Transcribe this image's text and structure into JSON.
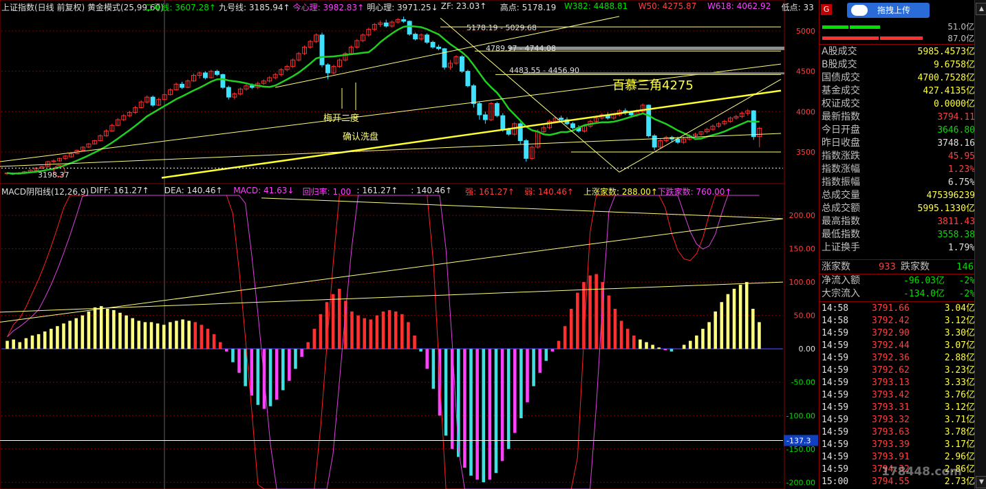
{
  "header": {
    "index_label": "上证指数(日线 前复权) 黄金模式(25,99,60)",
    "items": [
      {
        "text": "二号线: 3607.28↑",
        "color": "#00e000"
      },
      {
        "text": "九号线: 3185.94↑",
        "color": "#e0e0e0"
      },
      {
        "text": "今心理: 3982.83↑",
        "color": "#ff40ff"
      },
      {
        "text": "明心理: 3971.25↓",
        "color": "#e0e0e0"
      },
      {
        "text": "ZF: 23.03↑",
        "color": "#e0e0e0"
      },
      {
        "text": "高点: 5178.19",
        "color": "#e0e0e0"
      },
      {
        "text": "W382: 4488.81",
        "color": "#00e000"
      },
      {
        "text": "W50: 4275.87",
        "color": "#ff4040"
      },
      {
        "text": "W618: 4062.92",
        "color": "#ff40ff"
      },
      {
        "text": "低点: 33",
        "color": "#e0e0e0"
      }
    ]
  },
  "macd_header": {
    "items": [
      {
        "text": "MACD阴阳线(12,26,9)",
        "color": "#e0e0e0"
      },
      {
        "text": "DIFF: 161.27↑",
        "color": "#e0e0e0"
      },
      {
        "text": "DEA: 140.46↑",
        "color": "#e0e0e0"
      },
      {
        "text": "MACD: 41.63↓",
        "color": "#ff40ff"
      },
      {
        "text": "回归率: 1.00",
        "color": "#ff40ff"
      },
      {
        "text": ": 161.27↑",
        "color": "#e0e0e0"
      },
      {
        "text": ": 140.46↑",
        "color": "#e0e0e0"
      },
      {
        "text": "强: 161.27↑",
        "color": "#ff4040"
      },
      {
        "text": "弱: 140.46↑",
        "color": "#ff4040"
      },
      {
        "text": "上涨家数: 288.00↑",
        "color": "#ffff40"
      },
      {
        "text": "下跌家数: 760.00↑",
        "color": "#ff40ff"
      }
    ]
  },
  "annotations": {
    "a1": "5178.19 - 5029.68",
    "a2": "4789.97 - 4744.08",
    "a3": "4483.55 - 4456.90",
    "big": "百慕三角4275",
    "meikai": "梅开二度",
    "queren": "确认洗盘",
    "low": "3198.37",
    "macd_val": "-137.3"
  },
  "colors": {
    "up": "#ff3030",
    "down": "#40e0ff",
    "ma_green": "#20d020",
    "ma_yellow": "#ffff30",
    "grid": "#8b0000"
  },
  "chart_data": [
    {
      "type": "candlestick",
      "title": "上证指数(日线 前复权)",
      "ylim": [
        3198,
        5200
      ],
      "yticks": [
        3500,
        4000,
        4500,
        5000
      ],
      "candles": [
        [
          3230,
          3240,
          3215,
          3245
        ],
        [
          3235,
          3225,
          3215,
          3245
        ],
        [
          3225,
          3240,
          3220,
          3250
        ],
        [
          3240,
          3255,
          3235,
          3265
        ],
        [
          3255,
          3275,
          3250,
          3285
        ],
        [
          3270,
          3300,
          3265,
          3310
        ],
        [
          3300,
          3320,
          3290,
          3330
        ],
        [
          3320,
          3380,
          3310,
          3390
        ],
        [
          3380,
          3390,
          3360,
          3410
        ],
        [
          3390,
          3420,
          3380,
          3430
        ],
        [
          3420,
          3450,
          3400,
          3460
        ],
        [
          3440,
          3480,
          3430,
          3490
        ],
        [
          3480,
          3520,
          3470,
          3530
        ],
        [
          3520,
          3560,
          3510,
          3570
        ],
        [
          3560,
          3600,
          3550,
          3610
        ],
        [
          3600,
          3640,
          3590,
          3650
        ],
        [
          3640,
          3700,
          3630,
          3720
        ],
        [
          3700,
          3760,
          3690,
          3780
        ],
        [
          3760,
          3830,
          3750,
          3850
        ],
        [
          3830,
          3900,
          3820,
          3920
        ],
        [
          3900,
          3950,
          3880,
          3970
        ],
        [
          3950,
          3990,
          3930,
          4010
        ],
        [
          3990,
          4050,
          3970,
          4070
        ],
        [
          4050,
          4120,
          4040,
          4140
        ],
        [
          4120,
          4180,
          4100,
          4200
        ],
        [
          4180,
          4080,
          4060,
          4200
        ],
        [
          4080,
          4150,
          4070,
          4170
        ],
        [
          4150,
          4210,
          4140,
          4230
        ],
        [
          4210,
          4270,
          4200,
          4290
        ],
        [
          4270,
          4340,
          4260,
          4360
        ],
        [
          4340,
          4300,
          4280,
          4370
        ],
        [
          4300,
          4380,
          4290,
          4400
        ],
        [
          4380,
          4450,
          4370,
          4470
        ],
        [
          4450,
          4480,
          4410,
          4500
        ],
        [
          4480,
          4420,
          4400,
          4500
        ],
        [
          4420,
          4500,
          4410,
          4520
        ],
        [
          4500,
          4460,
          4440,
          4520
        ],
        [
          4460,
          4300,
          4280,
          4470
        ],
        [
          4300,
          4180,
          4150,
          4320
        ],
        [
          4180,
          4220,
          4150,
          4240
        ],
        [
          4220,
          4280,
          4200,
          4300
        ],
        [
          4280,
          4320,
          4260,
          4340
        ],
        [
          4320,
          4300,
          4280,
          4350
        ],
        [
          4300,
          4350,
          4280,
          4370
        ],
        [
          4350,
          4380,
          4330,
          4400
        ],
        [
          4380,
          4420,
          4360,
          4440
        ],
        [
          4420,
          4460,
          4400,
          4480
        ],
        [
          4460,
          4520,
          4440,
          4540
        ],
        [
          4520,
          4560,
          4500,
          4580
        ],
        [
          4560,
          4640,
          4540,
          4660
        ],
        [
          4640,
          4720,
          4620,
          4740
        ],
        [
          4720,
          4800,
          4700,
          4820
        ],
        [
          4800,
          4870,
          4780,
          4890
        ],
        [
          4870,
          4950,
          4850,
          4970
        ],
        [
          4950,
          4580,
          4550,
          4980
        ],
        [
          4580,
          4480,
          4400,
          4600
        ],
        [
          4480,
          4560,
          4460,
          4580
        ],
        [
          4560,
          4640,
          4540,
          4660
        ],
        [
          4640,
          4720,
          4620,
          4740
        ],
        [
          4720,
          4800,
          4700,
          4820
        ],
        [
          4800,
          4880,
          4780,
          4900
        ],
        [
          4880,
          4950,
          4860,
          4970
        ],
        [
          4950,
          5020,
          4930,
          5040
        ],
        [
          5020,
          5080,
          5000,
          5100
        ],
        [
          5080,
          5100,
          5050,
          5130
        ],
        [
          5100,
          5060,
          5040,
          5140
        ],
        [
          5060,
          5110,
          5040,
          5130
        ],
        [
          5110,
          5140,
          5090,
          5160
        ],
        [
          5140,
          5120,
          5100,
          5178
        ],
        [
          5120,
          4960,
          4940,
          5130
        ],
        [
          4960,
          4900,
          4880,
          4980
        ],
        [
          4900,
          4950,
          4880,
          4970
        ],
        [
          4950,
          4860,
          4840,
          4970
        ],
        [
          4860,
          4800,
          4780,
          4880
        ],
        [
          4800,
          4780,
          4760,
          4830
        ],
        [
          4780,
          4550,
          4520,
          4790
        ],
        [
          4550,
          4600,
          4520,
          4640
        ],
        [
          4600,
          4680,
          4580,
          4700
        ],
        [
          4680,
          4500,
          4480,
          4700
        ],
        [
          4500,
          4320,
          4300,
          4520
        ],
        [
          4320,
          4100,
          4050,
          4340
        ],
        [
          4100,
          3960,
          3900,
          4120
        ],
        [
          3960,
          3900,
          3850,
          4000
        ],
        [
          3900,
          4100,
          3880,
          4120
        ],
        [
          4100,
          3950,
          3930,
          4120
        ],
        [
          3950,
          3780,
          3750,
          3980
        ],
        [
          3780,
          3720,
          3700,
          3800
        ],
        [
          3720,
          3850,
          3700,
          3870
        ],
        [
          3850,
          3640,
          3600,
          3870
        ],
        [
          3640,
          3420,
          3380,
          3660
        ],
        [
          3420,
          3560,
          3400,
          3580
        ],
        [
          3560,
          3750,
          3540,
          3780
        ],
        [
          3750,
          3800,
          3730,
          3830
        ],
        [
          3800,
          3880,
          3780,
          3900
        ],
        [
          3880,
          3920,
          3860,
          3940
        ],
        [
          3920,
          3900,
          3870,
          3950
        ],
        [
          3900,
          3850,
          3830,
          3930
        ],
        [
          3850,
          3800,
          3780,
          3870
        ],
        [
          3800,
          3760,
          3740,
          3830
        ],
        [
          3760,
          3820,
          3740,
          3840
        ],
        [
          3820,
          3880,
          3800,
          3900
        ],
        [
          3880,
          3920,
          3860,
          3950
        ],
        [
          3920,
          3960,
          3900,
          3980
        ],
        [
          3960,
          3920,
          3900,
          3990
        ],
        [
          3920,
          3960,
          3900,
          3980
        ],
        [
          3960,
          4010,
          3940,
          4030
        ],
        [
          4010,
          3990,
          3960,
          4040
        ],
        [
          3990,
          3960,
          3940,
          4010
        ],
        [
          3960,
          4000,
          3940,
          4030
        ],
        [
          4000,
          4080,
          3980,
          4100
        ],
        [
          4080,
          3700,
          3680,
          4090
        ],
        [
          3700,
          3560,
          3520,
          3720
        ],
        [
          3560,
          3640,
          3540,
          3660
        ],
        [
          3640,
          3680,
          3620,
          3700
        ],
        [
          3680,
          3660,
          3620,
          3700
        ],
        [
          3660,
          3620,
          3600,
          3690
        ],
        [
          3620,
          3660,
          3600,
          3690
        ],
        [
          3660,
          3700,
          3640,
          3720
        ],
        [
          3700,
          3720,
          3680,
          3740
        ],
        [
          3720,
          3750,
          3700,
          3760
        ],
        [
          3750,
          3780,
          3730,
          3800
        ],
        [
          3780,
          3820,
          3760,
          3840
        ],
        [
          3820,
          3850,
          3800,
          3870
        ],
        [
          3850,
          3880,
          3830,
          3900
        ],
        [
          3880,
          3920,
          3860,
          3940
        ],
        [
          3920,
          3940,
          3900,
          3960
        ],
        [
          3940,
          3980,
          3920,
          4000
        ],
        [
          3980,
          4010,
          3950,
          4030
        ],
        [
          4010,
          3690,
          3650,
          4020
        ],
        [
          3690,
          3794,
          3558,
          3811
        ]
      ]
    },
    {
      "type": "bar",
      "title": "MACD阴阳线(12,26,9)",
      "ylim": [
        -210,
        230
      ],
      "yticks": [
        -200,
        -150,
        -100,
        -50,
        0,
        50,
        100,
        150,
        200
      ],
      "macd_hist": [
        12,
        14,
        10,
        16,
        20,
        22,
        26,
        30,
        34,
        38,
        42,
        46,
        50,
        56,
        62,
        64,
        60,
        58,
        54,
        50,
        46,
        42,
        40,
        40,
        38,
        36,
        40,
        42,
        44,
        42,
        40,
        36,
        30,
        22,
        10,
        -4,
        -20,
        -36,
        -56,
        -70,
        -84,
        -90,
        -86,
        -76,
        -62,
        -48,
        -30,
        -12,
        10,
        30,
        52,
        70,
        82,
        90,
        72,
        56,
        50,
        46,
        44,
        50,
        56,
        58,
        56,
        52,
        40,
        20,
        -4,
        -30,
        -60,
        -100,
        -130,
        -150,
        -162,
        -178,
        -190,
        -196,
        -200,
        -196,
        -186,
        -168,
        -150,
        -126,
        -104,
        -80,
        -56,
        -36,
        -18,
        -4,
        12,
        34,
        60,
        84,
        100,
        110,
        112,
        100,
        80,
        60,
        42,
        30,
        20,
        14,
        10,
        6,
        2,
        -2,
        -4,
        0,
        6,
        12,
        20,
        30,
        40,
        56,
        70,
        82,
        90,
        96,
        100,
        60,
        40
      ]
    }
  ],
  "side": {
    "stats": [
      {
        "k": "A股成交",
        "v": "5985.4573亿",
        "c": "#ffff40"
      },
      {
        "k": "B股成交",
        "v": "9.6758亿",
        "c": "#ffff40"
      },
      {
        "k": "国债成交",
        "v": "4700.7528亿",
        "c": "#ffff40"
      },
      {
        "k": "基金成交",
        "v": "427.4135亿",
        "c": "#ffff40"
      },
      {
        "k": "权证成交",
        "v": "0.0000亿",
        "c": "#ffff40"
      },
      {
        "k": "最新指数",
        "v": "3794.11",
        "c": "#ff4040"
      },
      {
        "k": "今日开盘",
        "v": "3646.80",
        "c": "#00e000"
      },
      {
        "k": "昨日收盘",
        "v": "3748.16",
        "c": "#e0e0e0"
      },
      {
        "k": "指数涨跌",
        "v": "45.95",
        "c": "#ff4040"
      },
      {
        "k": "指数涨幅",
        "v": "1.23%",
        "c": "#ff4040"
      },
      {
        "k": "指数振幅",
        "v": "6.75%",
        "c": "#e0e0e0"
      },
      {
        "k": "总成交量",
        "v": "475396239",
        "c": "#ffff40"
      },
      {
        "k": "总成交额",
        "v": "5995.1330亿",
        "c": "#ffff40"
      },
      {
        "k": "最高指数",
        "v": "3811.43",
        "c": "#ff4040"
      },
      {
        "k": "最低指数",
        "v": "3558.38",
        "c": "#00e000"
      },
      {
        "k": "上证换手",
        "v": "1.79%",
        "c": "#e0e0e0"
      }
    ],
    "updown": {
      "up_label": "涨家数",
      "up": "933",
      "down_label": "跌家数",
      "down": "146"
    },
    "flow": [
      {
        "k": "净流入额",
        "v": "-96.03亿",
        "p": "-2%"
      },
      {
        "k": "大宗流入",
        "v": "-134.0亿",
        "p": "-2%"
      }
    ],
    "ticks": [
      {
        "t": "14:58",
        "p": "3791.66",
        "a": "3.04亿"
      },
      {
        "t": "14:58",
        "p": "3792.42",
        "a": "3.12亿"
      },
      {
        "t": "14:59",
        "p": "3792.90",
        "a": "3.30亿"
      },
      {
        "t": "14:59",
        "p": "3792.44",
        "a": "3.07亿"
      },
      {
        "t": "14:59",
        "p": "3792.36",
        "a": "2.88亿"
      },
      {
        "t": "14:59",
        "p": "3792.62",
        "a": "3.23亿"
      },
      {
        "t": "14:59",
        "p": "3793.13",
        "a": "3.33亿"
      },
      {
        "t": "14:59",
        "p": "3793.42",
        "a": "3.76亿"
      },
      {
        "t": "14:59",
        "p": "3793.31",
        "a": "3.12亿"
      },
      {
        "t": "14:59",
        "p": "3793.32",
        "a": "3.71亿"
      },
      {
        "t": "14:59",
        "p": "3793.63",
        "a": "3.78亿"
      },
      {
        "t": "14:59",
        "p": "3793.39",
        "a": "3.17亿"
      },
      {
        "t": "14:59",
        "p": "3793.91",
        "a": "2.96亿"
      },
      {
        "t": "14:59",
        "p": "3794.32",
        "a": "2.86亿"
      },
      {
        "t": "15:00",
        "p": "3794.55",
        "a": "2.73亿"
      }
    ],
    "top": {
      "badge": "G",
      "upload": "拖拽上传",
      "v1": "51.0亿",
      "v2": "87.0亿"
    },
    "watermark": "178448.com"
  }
}
